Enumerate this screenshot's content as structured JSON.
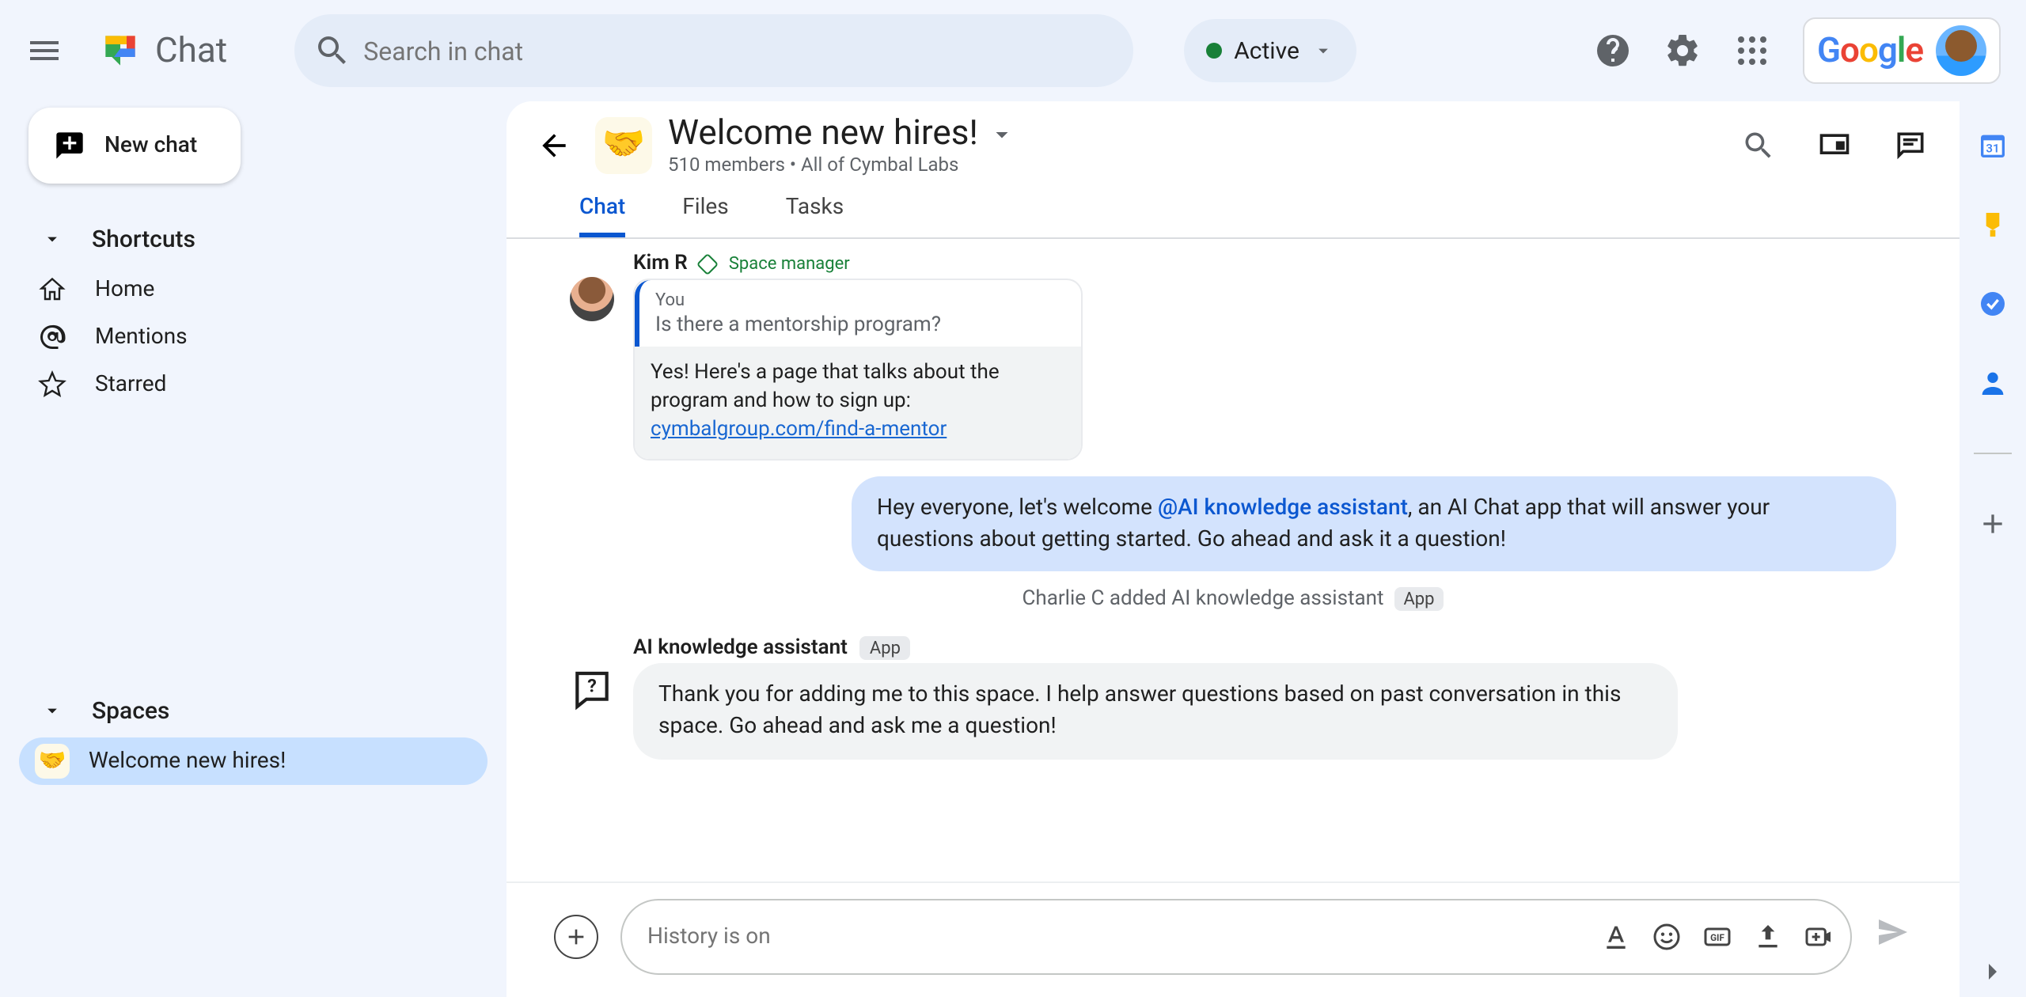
{
  "app_name": "Chat",
  "search_placeholder": "Search in chat",
  "status_label": "Active",
  "google_word": "Google",
  "nav": {
    "new_chat": "New chat",
    "shortcuts_label": "Shortcuts",
    "home_label": "Home",
    "mentions_label": "Mentions",
    "starred_label": "Starred",
    "spaces_label": "Spaces",
    "space_item_label": "Welcome new hires!",
    "space_item_emoji": "🤝"
  },
  "space": {
    "emoji": "🤝",
    "title": "Welcome new hires!",
    "subtitle": "510 members  •  All of Cymbal Labs"
  },
  "tabs": {
    "chat": "Chat",
    "files": "Files",
    "tasks": "Tasks"
  },
  "msg_kim": {
    "sender": "Kim R",
    "role": "Space manager",
    "quote_you": "You",
    "quote_text": "Is there a mentorship program?",
    "body_pre": "Yes! Here's a page that talks about the program and how to sign up: ",
    "link": "cymbalgroup.com/find-a-mentor"
  },
  "msg_blue": {
    "pre": "Hey everyone, let's welcome ",
    "mention": "@AI knowledge assistant",
    "post": ", an AI Chat app that will answer your questions about getting started.  Go ahead and ask it a question!"
  },
  "sys_line": {
    "text": "Charlie C added AI knowledge assistant",
    "chip": "App"
  },
  "msg_app": {
    "sender": "AI knowledge assistant",
    "chip": "App",
    "body": "Thank you for adding me to this space. I help answer questions based on past conversation in this space. Go ahead and ask me a question!"
  },
  "compose_placeholder": "History is on"
}
